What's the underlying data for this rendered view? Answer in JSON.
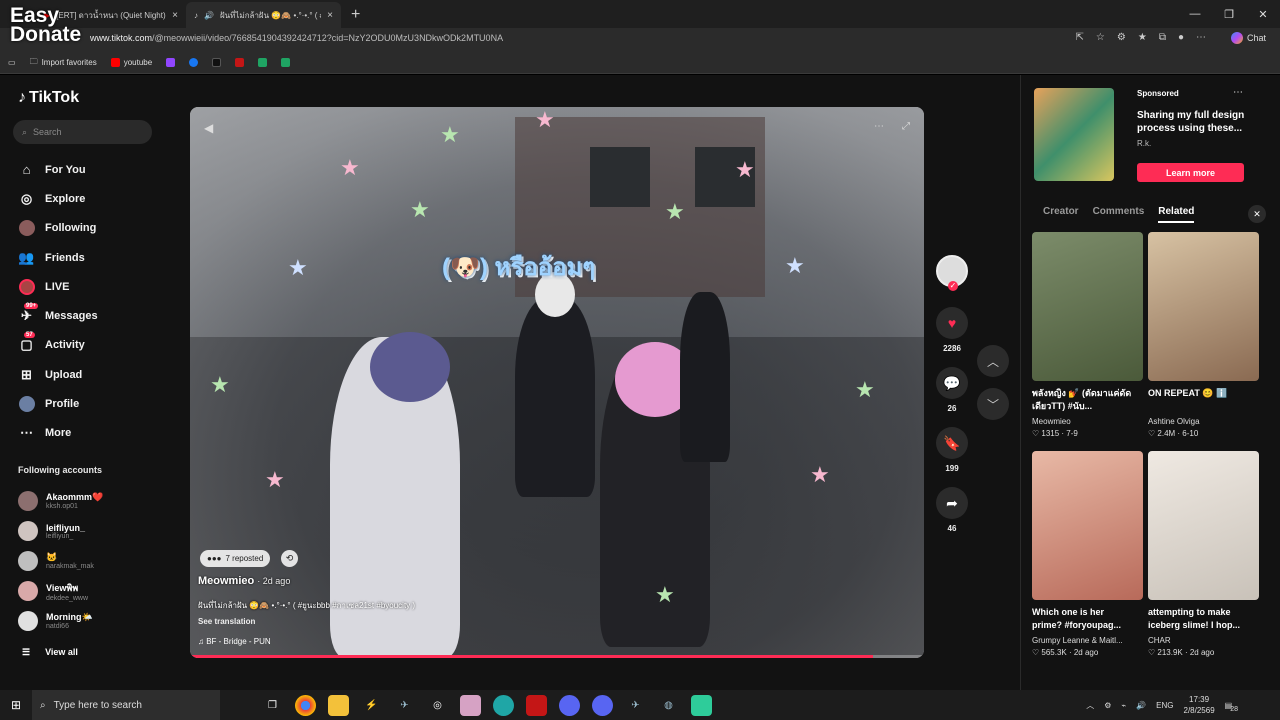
{
  "watermark": {
    "line1": "Easy",
    "line2": "Donate"
  },
  "browser": {
    "tabs": [
      {
        "label": "[ERT] ดาวน้ำหนา (Quiet Night) - You",
        "icon": "youtube-icon"
      },
      {
        "label": "ฝันที่ไม่กล้าฝัน 😳🙈 •.°·•.° ( #ฐ",
        "icon": "tiktok-icon"
      }
    ],
    "url_host": "www.tiktok.com",
    "url_path": "/@meowwieii/video/7668541904392424712?cid=NzY2ODU0MzU3NDkwODk2MTU0NA",
    "chat_label": "Chat",
    "favorites": [
      {
        "label": "Import favorites"
      },
      {
        "label": "youtube"
      }
    ]
  },
  "sidebar": {
    "logo": "TikTok",
    "search_placeholder": "Search",
    "nav": [
      {
        "label": "For You",
        "icon": "home-icon"
      },
      {
        "label": "Explore",
        "icon": "compass-icon"
      },
      {
        "label": "Following",
        "icon": "following-icon"
      },
      {
        "label": "Friends",
        "icon": "friends-icon"
      },
      {
        "label": "LIVE",
        "icon": "live-icon"
      },
      {
        "label": "Messages",
        "icon": "messages-icon",
        "badge": "99+"
      },
      {
        "label": "Activity",
        "icon": "activity-icon",
        "badge": "57"
      },
      {
        "label": "Upload",
        "icon": "upload-icon"
      },
      {
        "label": "Profile",
        "icon": "profile-icon"
      },
      {
        "label": "More",
        "icon": "more-icon"
      }
    ],
    "following_title": "Following accounts",
    "accounts": [
      {
        "name": "Akaommm❤️",
        "handle": "kksh.op01"
      },
      {
        "name": "leifliyun_",
        "handle": "leifliyun_"
      },
      {
        "name": "🐱",
        "handle": "narakmak_mak"
      },
      {
        "name": "Viewพิพ",
        "handle": "dekdee_www"
      },
      {
        "name": "Morning🌤️",
        "handle": "natdi66"
      }
    ],
    "view_all": "View all"
  },
  "video": {
    "overlay_text": "(🐶) หรืออ้อมๆ",
    "reposted": "7 reposted",
    "author": "Meowmieo",
    "ago": "· 2d ago",
    "caption": "ฝันที่ไม่กล้าฝัน 😳🙈 •.°·•.° ( #ยูนะbbb #กาเซล21st #byoucity )",
    "see_translation": "See translation",
    "music": "♫  BF - Bridge - PUN",
    "progress": 0.93
  },
  "actions": {
    "likes": "2286",
    "comments": "26",
    "saves": "199",
    "shares": "46"
  },
  "ad": {
    "sponsored": "Sponsored",
    "title": "Sharing my full design process using these...",
    "by": "R.k.",
    "cta": "Learn more"
  },
  "right_tabs": {
    "creator": "Creator",
    "comments": "Comments",
    "related": "Related"
  },
  "related": [
    {
      "title": "พลังหญิง 💅 (ตัดมาแค่ดัดเดียวTT) #นับ...",
      "author": "Meowmieo",
      "stats": "♡ 1315 · 7-9",
      "color1": "#4b5a3a",
      "color2": "#7c8c6a"
    },
    {
      "title": "ON REPEAT 😊 ℹ️",
      "author": "Ashtine Olviga",
      "stats": "♡ 2.4M · 6-10",
      "color1": "#8a6a52",
      "color2": "#d7c2a3"
    },
    {
      "title": "Which one is her prime? #foryoupag...",
      "author": "Grumpy Leanne & Maitl...",
      "stats": "♡ 565.3K · 2d ago",
      "color1": "#b86a5a",
      "color2": "#e8b9a6"
    },
    {
      "title": "attempting to make iceberg slime! I hop...",
      "author": "CHAR",
      "stats": "♡ 213.9K · 2d ago",
      "color1": "#c9c2b9",
      "color2": "#efe9e2"
    }
  ],
  "taskbar": {
    "search_placeholder": "Type here to search",
    "lang": "ENG",
    "time": "17:39",
    "date": "2/8/2569",
    "notif": "28"
  }
}
